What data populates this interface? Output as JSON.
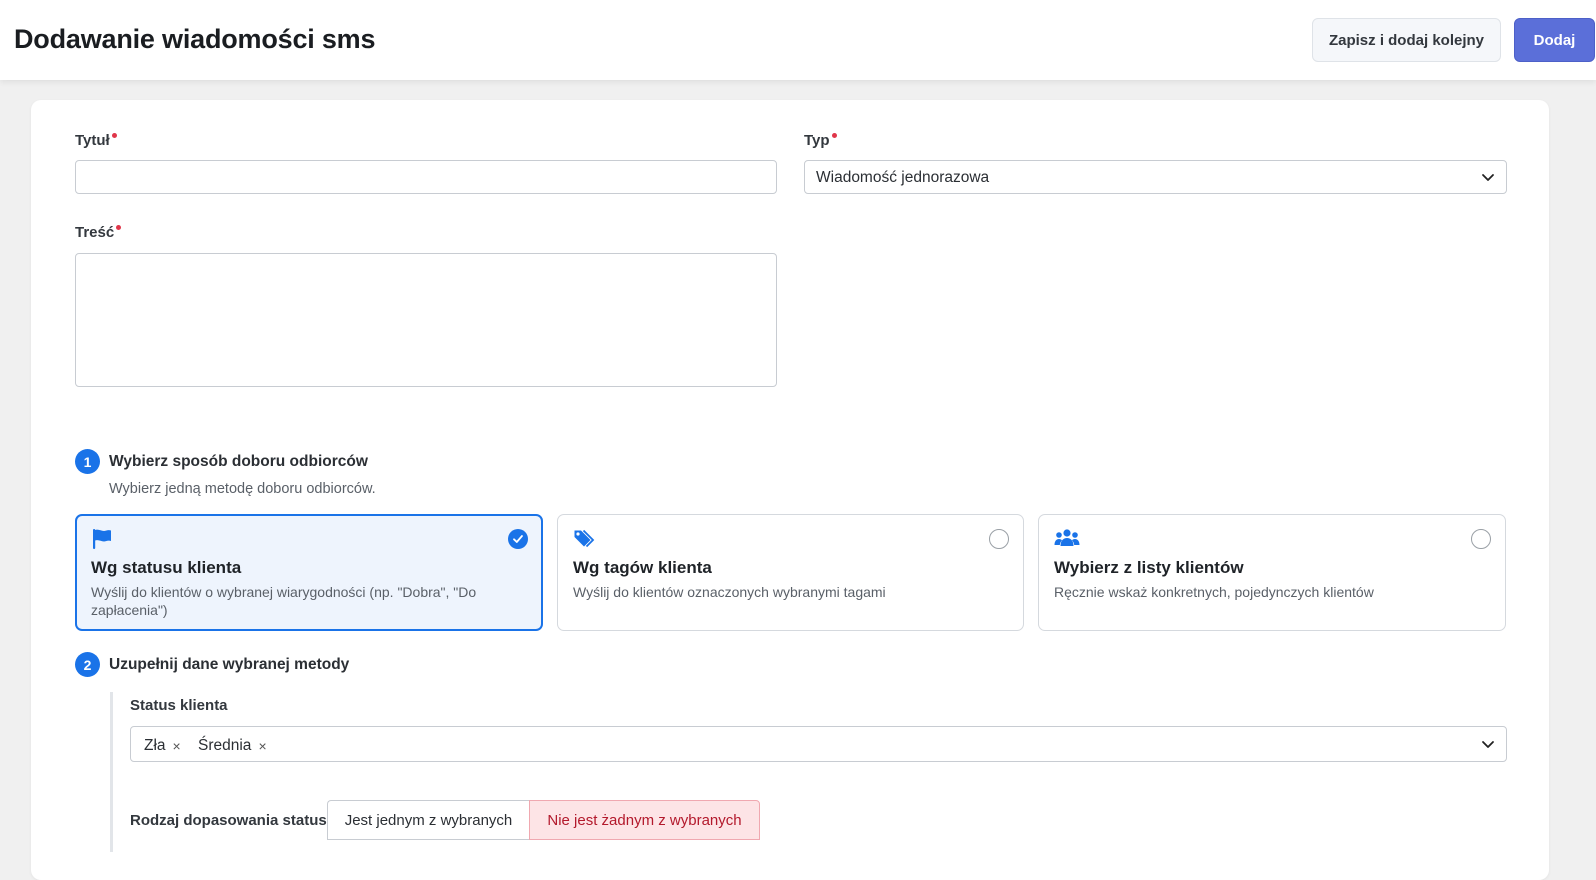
{
  "header": {
    "title": "Dodawanie wiadomości sms",
    "save_and_add_label": "Zapisz i dodaj kolejny",
    "add_label": "Dodaj"
  },
  "form": {
    "title_label": "Tytuł",
    "title_value": "",
    "type_label": "Typ",
    "type_value": "Wiadomość jednorazowa",
    "content_label": "Treść",
    "content_value": ""
  },
  "step1": {
    "number": "1",
    "title": "Wybierz sposób doboru odbiorców",
    "subtitle": "Wybierz jedną metodę doboru odbiorców.",
    "options": [
      {
        "icon": "flag-icon",
        "title": "Wg statusu klienta",
        "description": "Wyślij do klientów o wybranej wiarygodności (np. \"Dobra\", \"Do zapłacenia\")",
        "selected": true
      },
      {
        "icon": "tag-icon",
        "title": "Wg tagów klienta",
        "description": "Wyślij do klientów oznaczonych wybranymi tagami",
        "selected": false
      },
      {
        "icon": "users-icon",
        "title": "Wybierz z listy klientów",
        "description": "Ręcznie wskaż konkretnych, pojedynczych klientów",
        "selected": false
      }
    ]
  },
  "step2": {
    "number": "2",
    "title": "Uzupełnij dane wybranej metody",
    "status_label": "Status klienta",
    "selected_statuses": [
      "Zła",
      "Średnia"
    ],
    "match_label": "Rodzaj dopasowania statusu",
    "match_options": [
      "Jest jednym z wybranych",
      "Nie jest żadnym z wybranych"
    ],
    "match_selected": "Nie jest żadnym z wybranych"
  },
  "colors": {
    "primary": "#1a73e8",
    "button_primary": "#5b6fd9",
    "required": "#e0364a",
    "danger_text": "#b3192c",
    "danger_bg": "#fde4e6"
  }
}
